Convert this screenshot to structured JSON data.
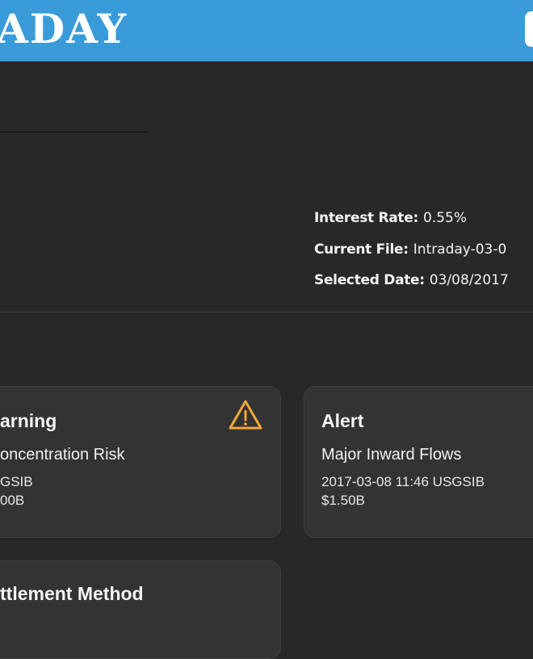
{
  "app": {
    "brand": "ADAY"
  },
  "info": {
    "interest_rate_label": "Interest Rate:",
    "interest_rate_value": "0.55%",
    "current_file_label": "Current File:",
    "current_file_value": "Intraday-03-0",
    "selected_date_label": "Selected Date:",
    "selected_date_value": "03/08/2017"
  },
  "cards": {
    "warning": {
      "title": "arning",
      "subtitle": "oncentration Risk",
      "line1": "GSIB",
      "line2": "00B",
      "icon": "warning-triangle-icon",
      "icon_color": "#f0a93a"
    },
    "alert": {
      "title": "Alert",
      "subtitle": "Major Inward Flows",
      "line1": "2017-03-08 11:46 USGSIB",
      "line2": "$1.50B"
    },
    "settlement": {
      "title": "ttlement Method"
    }
  },
  "colors": {
    "topbar": "#3a9bd9",
    "background": "#282828",
    "card": "#333333",
    "warning": "#f0a93a"
  }
}
